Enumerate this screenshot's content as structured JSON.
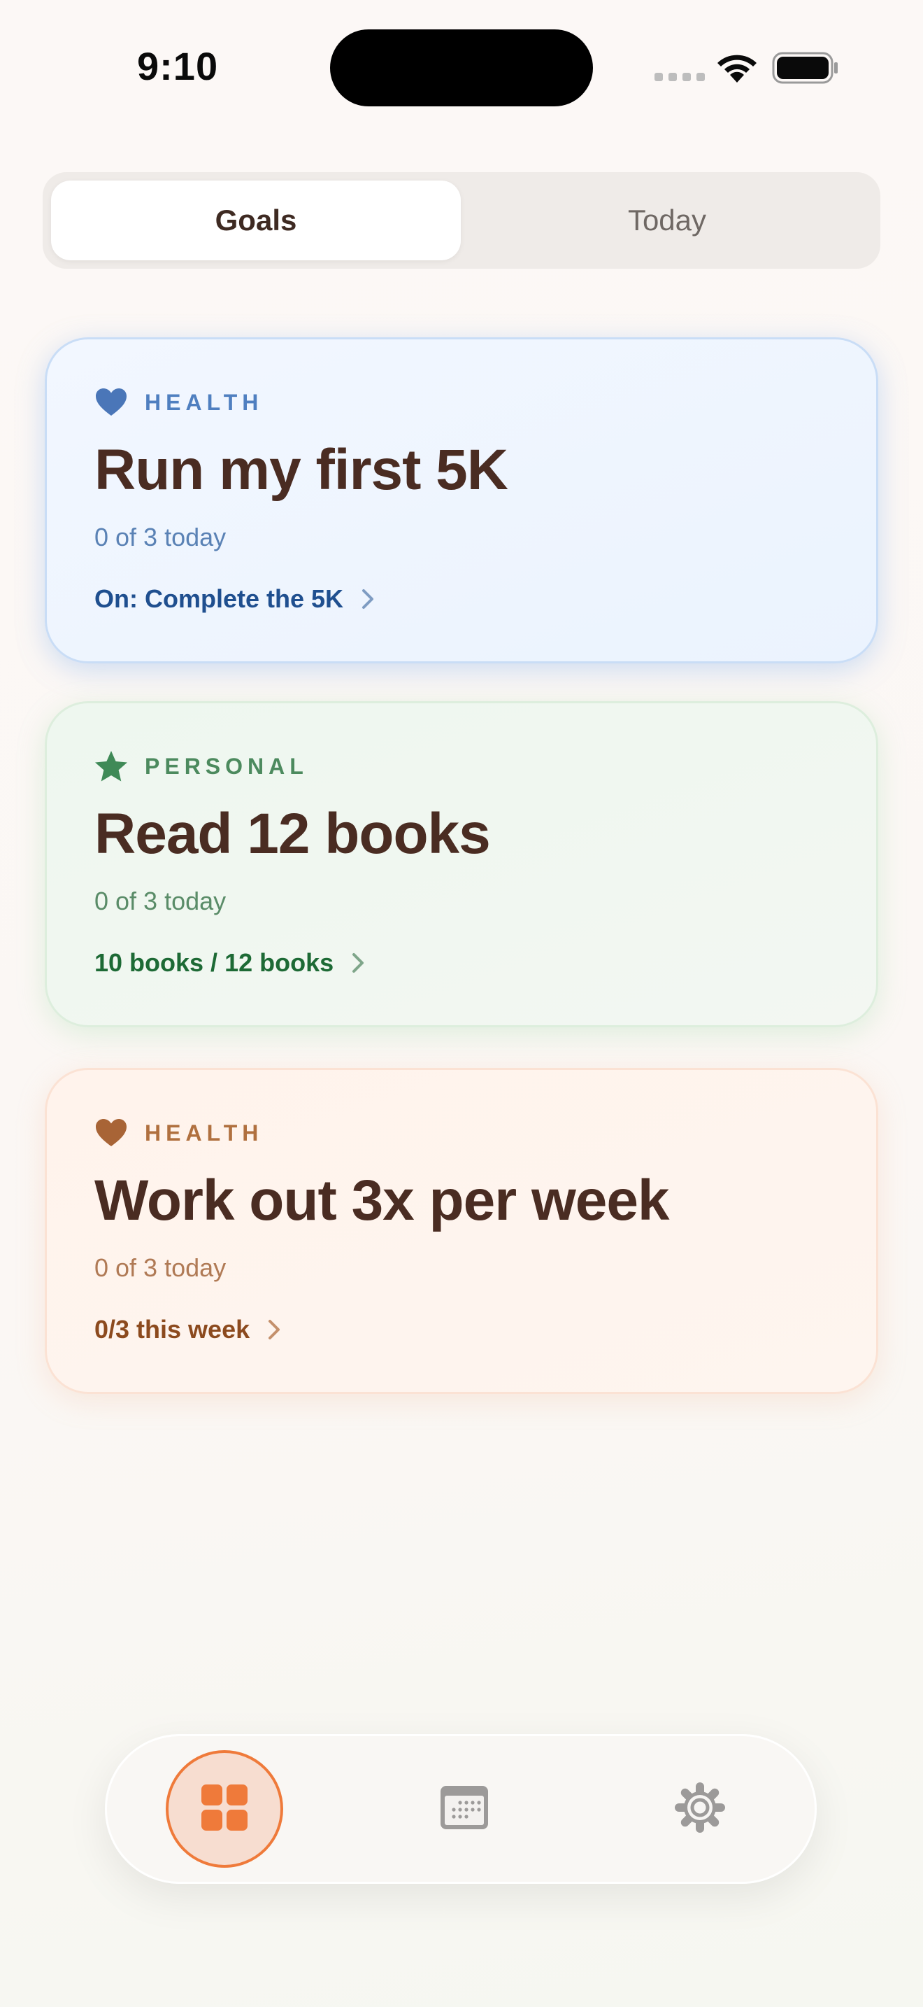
{
  "status_bar": {
    "time": "9:10"
  },
  "segmented_control": {
    "options": [
      "Goals",
      "Today"
    ],
    "selected": "Goals"
  },
  "goals": [
    {
      "category": "HEALTH",
      "category_icon": "heart-icon",
      "title": "Run my first 5K",
      "progress": "0 of 3 today",
      "link": "On: Complete the 5K",
      "accent_color": "#4f7fc0"
    },
    {
      "category": "PERSONAL",
      "category_icon": "star-icon",
      "title": "Read 12 books",
      "progress": "0 of 3 today",
      "link": "10 books / 12 books",
      "accent_color": "#3f8a57"
    },
    {
      "category": "HEALTH",
      "category_icon": "heart-icon",
      "title": "Work out 3x per week",
      "progress": "0 of 3 today",
      "link": "0/3 this week",
      "accent_color": "#b0703f"
    }
  ],
  "tab_bar": {
    "items": [
      {
        "name": "home",
        "icon": "grid-icon",
        "selected": true
      },
      {
        "name": "calendar",
        "icon": "calendar-icon",
        "selected": false
      },
      {
        "name": "settings",
        "icon": "gear-icon",
        "selected": false
      }
    ],
    "accent_color": "#ef7a3a"
  }
}
